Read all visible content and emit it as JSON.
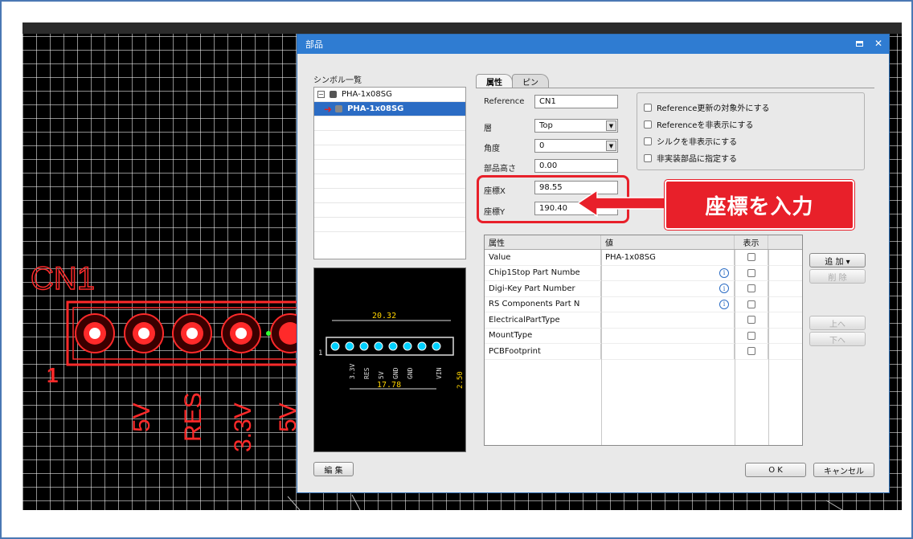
{
  "dialog": {
    "title": "部品",
    "symbol_list_label": "シンボル一覧",
    "symbols": [
      "PHA-1x08SG",
      "PHA-1x08SG"
    ],
    "tabs": [
      "属性",
      "ピン"
    ],
    "fields": {
      "reference_label": "Reference",
      "reference_value": "CN1",
      "layer_label": "層",
      "layer_value": "Top",
      "angle_label": "角度",
      "angle_value": "0",
      "height_label": "部品高さ",
      "height_value": "0.00",
      "x_label": "座標X",
      "x_value": "98.55",
      "y_label": "座標Y",
      "y_value": "190.40"
    },
    "options": [
      "Reference更新の対象外にする",
      "Referenceを非表示にする",
      "シルクを非表示にする",
      "非実装部品に指定する"
    ],
    "callout": "座標を入力",
    "table": {
      "headers": [
        "属性",
        "値",
        "表示"
      ],
      "rows": [
        {
          "name": "Value",
          "value": "PHA-1x08SG",
          "info": false
        },
        {
          "name": "Chip1Stop Part Numbe",
          "value": "",
          "info": true
        },
        {
          "name": "Digi-Key Part Number",
          "value": "",
          "info": true
        },
        {
          "name": "RS Components Part N",
          "value": "",
          "info": true
        },
        {
          "name": "ElectricalPartType",
          "value": "",
          "info": false
        },
        {
          "name": "MountType",
          "value": "",
          "info": false
        },
        {
          "name": "PCBFootprint",
          "value": "",
          "info": false
        }
      ]
    },
    "side_buttons": {
      "add": "追 加 ▾",
      "delete": "削 除",
      "up": "上へ",
      "down": "下へ"
    },
    "edit_button": "編 集",
    "ok_button": "O K",
    "cancel_button": "キャンセル"
  },
  "pcb": {
    "reference": "CN1",
    "pin1": "1",
    "net_labels": [
      "5V",
      "RES",
      "3.3V",
      "5V"
    ]
  },
  "preview": {
    "width_dim": "20.32",
    "pitch_dim": "17.78",
    "side_dim": "2.50",
    "pin_labels": [
      "3.3V",
      "RES",
      "5V",
      "GND",
      "GND",
      "VIN"
    ]
  }
}
